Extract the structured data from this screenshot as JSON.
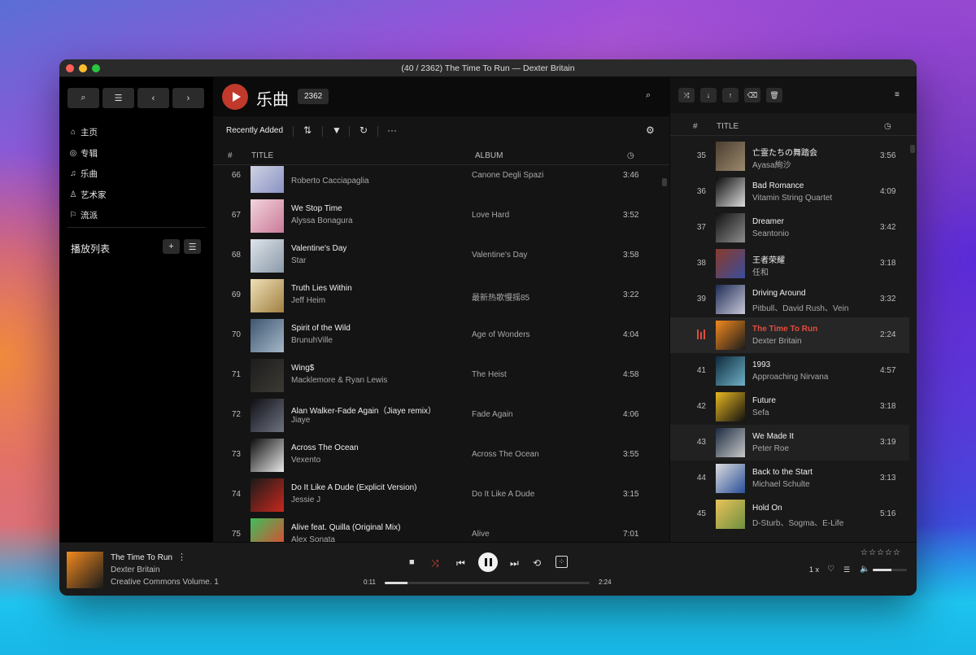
{
  "window": {
    "title": "(40 / 2362) The Time To Run — Dexter Britain"
  },
  "colors": {
    "accent": "#c0392b",
    "active_text": "#e54b3c",
    "background": "#141414"
  },
  "sidebar": {
    "buttons": [
      {
        "icon": "search-icon",
        "glyph": "⌕"
      },
      {
        "icon": "menu-icon",
        "glyph": "☰"
      },
      {
        "icon": "chevron-left-icon",
        "glyph": "‹"
      },
      {
        "icon": "chevron-right-icon",
        "glyph": "›"
      }
    ],
    "nav": [
      {
        "label": "主页",
        "icon": "home-icon",
        "glyph": "⌂"
      },
      {
        "label": "专辑",
        "icon": "disc-icon",
        "glyph": "◎"
      },
      {
        "label": "乐曲",
        "icon": "music-note-icon",
        "glyph": "♫"
      },
      {
        "label": "艺术家",
        "icon": "user-icon",
        "glyph": "♙"
      },
      {
        "label": "流派",
        "icon": "flag-icon",
        "glyph": "⚐"
      }
    ],
    "playlist_title": "播放列表",
    "playlist_add": "+",
    "playlist_list": "☰"
  },
  "main": {
    "title": "乐曲",
    "count": "2362",
    "sort_label": "Recently Added",
    "columns": {
      "num": "#",
      "title": "TITLE",
      "album": "ALBUM"
    },
    "rows": [
      {
        "num": "66",
        "title": "",
        "artist": "Roberto Cacciapaglia",
        "album": "Canone Degli Spazi",
        "duration": "3:46",
        "art": [
          "#d7d9e6",
          "#8a93c4"
        ]
      },
      {
        "num": "67",
        "title": "We Stop Time",
        "artist": "Alyssa Bonagura",
        "album": "Love Hard",
        "duration": "3:52",
        "art": [
          "#f3d4dc",
          "#c97a98"
        ]
      },
      {
        "num": "68",
        "title": "Valentine's Day",
        "artist": "Star",
        "album": "Valentine's Day",
        "duration": "3:58",
        "art": [
          "#dfe4ea",
          "#8a99a8"
        ]
      },
      {
        "num": "69",
        "title": "Truth Lies Within",
        "artist": "Jeff Heim",
        "album": "最新热歌慢摇85",
        "duration": "3:22",
        "art": [
          "#efe0b8",
          "#a08040"
        ]
      },
      {
        "num": "70",
        "title": "Spirit of the Wild",
        "artist": "BrunuhVille",
        "album": "Age of Wonders",
        "duration": "4:04",
        "art": [
          "#3e5670",
          "#a6b8c9"
        ]
      },
      {
        "num": "71",
        "title": "Wing$",
        "artist": "Macklemore & Ryan Lewis",
        "album": "The Heist",
        "duration": "4:58",
        "art": [
          "#1c1c1c",
          "#3d3a34"
        ]
      },
      {
        "num": "72",
        "title": "Alan Walker-Fade Again（Jiaye remix）",
        "artist": "Jiaye",
        "album": "Fade Again",
        "duration": "4:06",
        "art": [
          "#0f0f14",
          "#6e7382"
        ]
      },
      {
        "num": "73",
        "title": "Across The Ocean",
        "artist": "Vexento",
        "album": "Across The Ocean",
        "duration": "3:55",
        "art": [
          "#0d0d0d",
          "#e8e8e8"
        ]
      },
      {
        "num": "74",
        "title": "Do It Like A Dude (Explicit Version)",
        "artist": "Jessie J",
        "album": "Do It Like A Dude",
        "duration": "3:15",
        "art": [
          "#1a1a1a",
          "#c8281e"
        ]
      },
      {
        "num": "75",
        "title": "Alive feat. Quilla (Original Mix)",
        "artist": "Alex Sonata",
        "album": "Alive",
        "duration": "7:01",
        "art": [
          "#3fbf5a",
          "#e8402e"
        ]
      }
    ]
  },
  "queue": {
    "columns": {
      "num": "#",
      "title": "TITLE"
    },
    "buttons": [
      {
        "icon": "shuffle-icon",
        "glyph": "⤨"
      },
      {
        "icon": "arrow-down-icon",
        "glyph": "↓"
      },
      {
        "icon": "arrow-up-icon",
        "glyph": "↑"
      },
      {
        "icon": "eraser-icon",
        "glyph": "⌫"
      },
      {
        "icon": "trash-icon",
        "glyph": "🗑"
      }
    ],
    "rows": [
      {
        "num": "35",
        "title": "亡霊たちの舞踏会",
        "artist": "Ayasa絢沙",
        "duration": "3:56",
        "art": [
          "#4a3d30",
          "#9c8a6e"
        ]
      },
      {
        "num": "36",
        "title": "Bad Romance",
        "artist": "Vitamin String Quartet",
        "duration": "4:09",
        "art": [
          "#0b0b0b",
          "#dcdcdc"
        ]
      },
      {
        "num": "37",
        "title": "Dreamer",
        "artist": "Seantonio",
        "duration": "3:42",
        "art": [
          "#111111",
          "#8d8d8d"
        ]
      },
      {
        "num": "38",
        "title": "王者荣耀",
        "artist": "任和",
        "duration": "3:18",
        "art": [
          "#8a3a2a",
          "#3a4d9c"
        ]
      },
      {
        "num": "39",
        "title": "Driving Around",
        "artist": "Pitbull、David Rush、Vein",
        "duration": "3:32",
        "art": [
          "#1e2c55",
          "#c8c8d8"
        ]
      },
      {
        "num": "40",
        "title": "The Time To Run",
        "artist": "Dexter Britain",
        "duration": "2:24",
        "art": [
          "#f28a1e",
          "#1b1b1b"
        ],
        "active": true
      },
      {
        "num": "41",
        "title": "1993",
        "artist": "Approaching Nirvana",
        "duration": "4:57",
        "art": [
          "#0e2a3a",
          "#6fb0c8"
        ]
      },
      {
        "num": "42",
        "title": "Future",
        "artist": "Sefa",
        "duration": "3:18",
        "art": [
          "#e8b820",
          "#111111"
        ]
      },
      {
        "num": "43",
        "title": "We Made It",
        "artist": "Peter Roe",
        "duration": "3:19",
        "art": [
          "#1b2a40",
          "#c9c9c9"
        ],
        "hover": true
      },
      {
        "num": "44",
        "title": "Back to the Start",
        "artist": "Michael Schulte",
        "duration": "3:13",
        "art": [
          "#dcdcdc",
          "#2a4f9a"
        ]
      },
      {
        "num": "45",
        "title": "Hold On",
        "artist": "D-Sturb、Sogma、E-Life",
        "duration": "5:16",
        "art": [
          "#e9c35a",
          "#6e8f3e"
        ]
      }
    ]
  },
  "player": {
    "title": "The Time To Run",
    "artist": "Dexter Britain",
    "album": "Creative Commons Volume. 1",
    "current_time": "0:11",
    "total_time": "2:24",
    "progress": 0.11,
    "rate": "1 x",
    "volume": 0.55,
    "rating": 0,
    "stars": [
      "☆",
      "☆",
      "☆",
      "☆",
      "☆"
    ],
    "art": [
      "#f28a1e",
      "#1b1b1b"
    ]
  }
}
